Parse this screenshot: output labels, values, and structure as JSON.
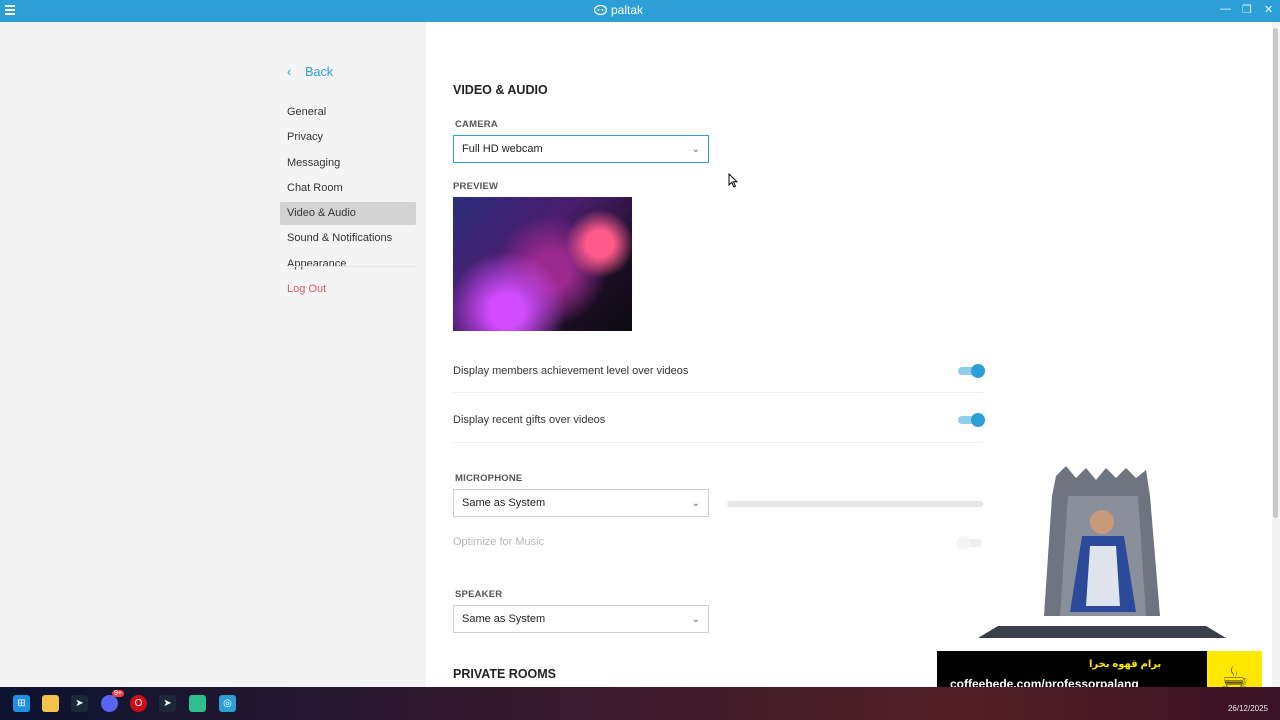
{
  "app": {
    "name": "paltak"
  },
  "sidebar": {
    "back_label": "Back",
    "items": [
      {
        "label": "General"
      },
      {
        "label": "Privacy"
      },
      {
        "label": "Messaging"
      },
      {
        "label": "Chat Room"
      },
      {
        "label": "Video & Audio",
        "active": true
      },
      {
        "label": "Sound & Notifications"
      },
      {
        "label": "Appearance"
      }
    ],
    "logout_label": "Log Out"
  },
  "main": {
    "section_title": "VIDEO & AUDIO",
    "camera_label": "CAMERA",
    "camera_value": "Full HD webcam",
    "preview_label": "PREVIEW",
    "toggles": [
      {
        "label": "Display members achievement level over videos",
        "on": true
      },
      {
        "label": "Display recent gifts over videos",
        "on": true
      }
    ],
    "microphone_label": "MICROPHONE",
    "microphone_value": "Same as System",
    "microphone_level": 0,
    "optimize_label": "Optimize for Music",
    "optimize_on": false,
    "speaker_label": "SPEAKER",
    "speaker_value": "Same as System",
    "next_section": "PRIVATE ROOMS"
  },
  "overlay": {
    "promo_fa": "برام قهوه بخرا",
    "promo_url": "coffeebede.com/professorpalang"
  },
  "taskbar": {
    "date": "26/12/2025",
    "discord_badge": "9+"
  },
  "colors": {
    "accent": "#2c9fd7",
    "logout": "#e0566a"
  }
}
